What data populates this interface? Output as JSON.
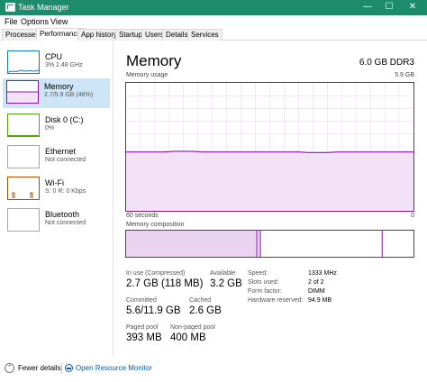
{
  "window": {
    "title": "Task Manager"
  },
  "window_controls": {
    "minimize": "—",
    "maximize": "☐",
    "close": "✕"
  },
  "menu": [
    "File",
    "Options",
    "View"
  ],
  "tabs": [
    "Processes",
    "Performance",
    "App history",
    "Startup",
    "Users",
    "Details",
    "Services"
  ],
  "active_tab": "Performance",
  "sidebar": [
    {
      "title": "CPU",
      "subtitle": "3% 2.48 GHz",
      "color": "#117dbb"
    },
    {
      "title": "Memory",
      "subtitle": "2.7/5.9 GB (46%)",
      "color": "#8b12ae",
      "selected": true
    },
    {
      "title": "Disk 0 (C:)",
      "subtitle": "0%",
      "color": "#4da60c"
    },
    {
      "title": "Ethernet",
      "subtitle": "Not connected",
      "color": "#a7a7a7"
    },
    {
      "title": "Wi-Fi",
      "subtitle": "S: 0 R: 0 Kbps",
      "color": "#a74f01"
    },
    {
      "title": "Bluetooth",
      "subtitle": "Not connected",
      "color": "#a7a7a7"
    }
  ],
  "main": {
    "title": "Memory",
    "total": "6.0 GB DDR3",
    "graph_label": "Memory usage",
    "graph_max": "5.9 GB",
    "graph_time": "60 seconds",
    "graph_min": "0",
    "composition_label": "Memory composition",
    "accent_color": "#8b12ae",
    "usage_fraction": 0.46
  },
  "stats": {
    "in_use_label": "In use (Compressed)",
    "in_use_value": "2.7 GB (118 MB)",
    "available_label": "Available",
    "available_value": "3.2 GB",
    "committed_label": "Committed",
    "committed_value": "5.6/11.9 GB",
    "cached_label": "Cached",
    "cached_value": "2.6 GB",
    "paged_label": "Paged pool",
    "paged_value": "393 MB",
    "nonpaged_label": "Non-paged pool",
    "nonpaged_value": "400 MB"
  },
  "specs": [
    {
      "label": "Speed:",
      "value": "1333 MHz"
    },
    {
      "label": "Slots used:",
      "value": "2 of 2"
    },
    {
      "label": "Form factor:",
      "value": "DIMM"
    },
    {
      "label": "Hardware reserved:",
      "value": "94.9 MB"
    }
  ],
  "footer": {
    "fewer_details": "Fewer details",
    "open_monitor": "Open Resource Monitor"
  }
}
